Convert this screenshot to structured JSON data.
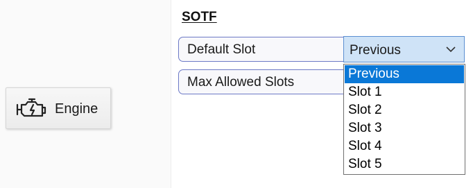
{
  "toolbar": {
    "engine_button": {
      "label": "Engine",
      "icon": "engine-icon"
    }
  },
  "sotf": {
    "title": "SOTF",
    "default_slot": {
      "label": "Default Slot",
      "selected_value": "Previous",
      "dropdown_open": true,
      "options": [
        "Previous",
        "Slot 1",
        "Slot 2",
        "Slot 3",
        "Slot 4",
        "Slot 5"
      ]
    },
    "max_allowed_slots": {
      "label": "Max Allowed Slots"
    }
  },
  "colors": {
    "selection_highlight": "#0a78d7",
    "combo_background": "#cfe3f7",
    "field_border": "#6b78c6"
  }
}
